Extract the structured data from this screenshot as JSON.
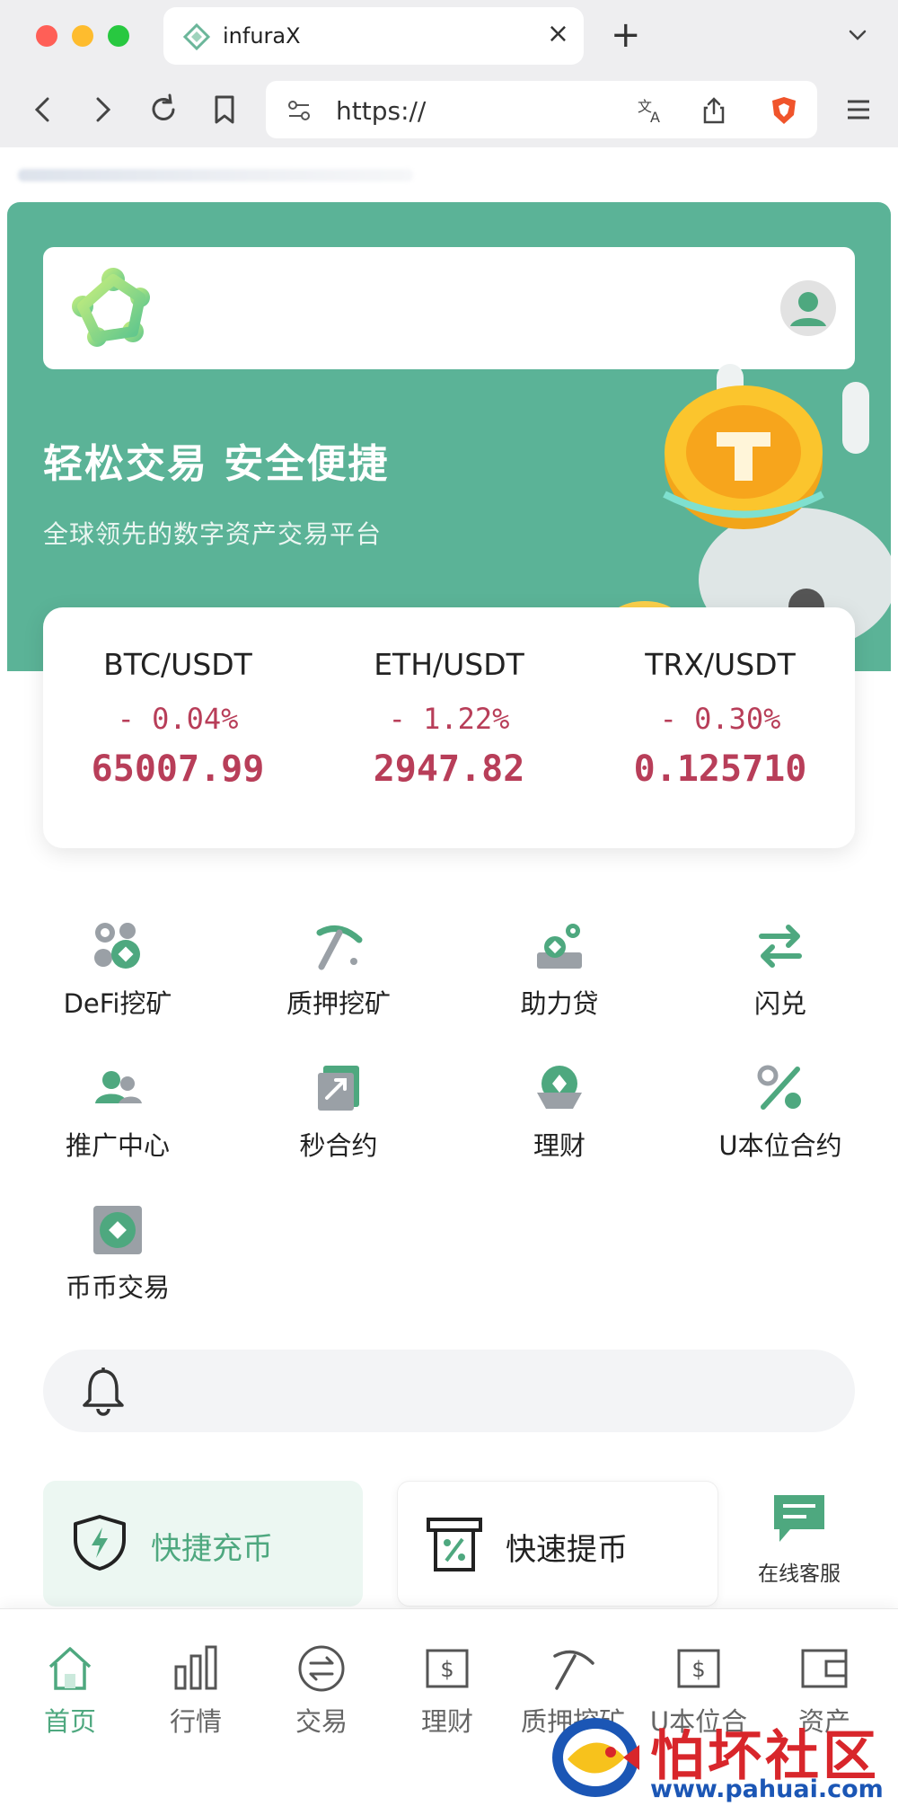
{
  "browser": {
    "tab_title": "infuraX",
    "tab_close": "×",
    "new_tab": "+",
    "url": "https://"
  },
  "header": {
    "logo": "infurax-logo-icon",
    "avatar": "user-avatar-icon"
  },
  "hero": {
    "title": "轻松交易 安全便捷",
    "subtitle": "全球领先的数字资产交易平台"
  },
  "tickers": [
    {
      "pair": "BTC/USDT",
      "change": "- 0.04%",
      "price": "65007.99"
    },
    {
      "pair": "ETH/USDT",
      "change": "- 1.22%",
      "price": "2947.82"
    },
    {
      "pair": "TRX/USDT",
      "change": "- 0.30%",
      "price": "0.125710"
    }
  ],
  "menu": [
    {
      "label": "DeFi挖矿",
      "icon": "coins-icon"
    },
    {
      "label": "质押挖矿",
      "icon": "pickaxe-icon"
    },
    {
      "label": "助力贷",
      "icon": "loan-icon"
    },
    {
      "label": "闪兑",
      "icon": "swap-arrows-icon"
    },
    {
      "label": "推广中心",
      "icon": "users-icon"
    },
    {
      "label": "秒合约",
      "icon": "contract-icon"
    },
    {
      "label": "理财",
      "icon": "wealth-icon"
    },
    {
      "label": "U本位合约",
      "icon": "percent-icon"
    },
    {
      "label": "币币交易",
      "icon": "coin-exchange-icon"
    }
  ],
  "actions": {
    "deposit": "快捷充币",
    "withdraw": "快速提币",
    "support": "在线客服"
  },
  "bottom_nav": [
    {
      "label": "首页",
      "icon": "home-icon",
      "active": true
    },
    {
      "label": "行情",
      "icon": "bar-chart-icon",
      "active": false
    },
    {
      "label": "交易",
      "icon": "exchange-icon",
      "active": false
    },
    {
      "label": "理财",
      "icon": "finance-icon",
      "active": false
    },
    {
      "label": "质押挖矿",
      "icon": "pickaxe-icon",
      "active": false
    },
    {
      "label": "U本位合",
      "icon": "usdt-contract-icon",
      "active": false
    },
    {
      "label": "资产",
      "icon": "wallet-icon",
      "active": false
    }
  ],
  "watermark": {
    "name": "怕坏社区",
    "url": "www.pahuai.com"
  },
  "colors": {
    "brand_green": "#5bb397",
    "accent_green": "#4ea87f",
    "negative": "#b83e59"
  }
}
